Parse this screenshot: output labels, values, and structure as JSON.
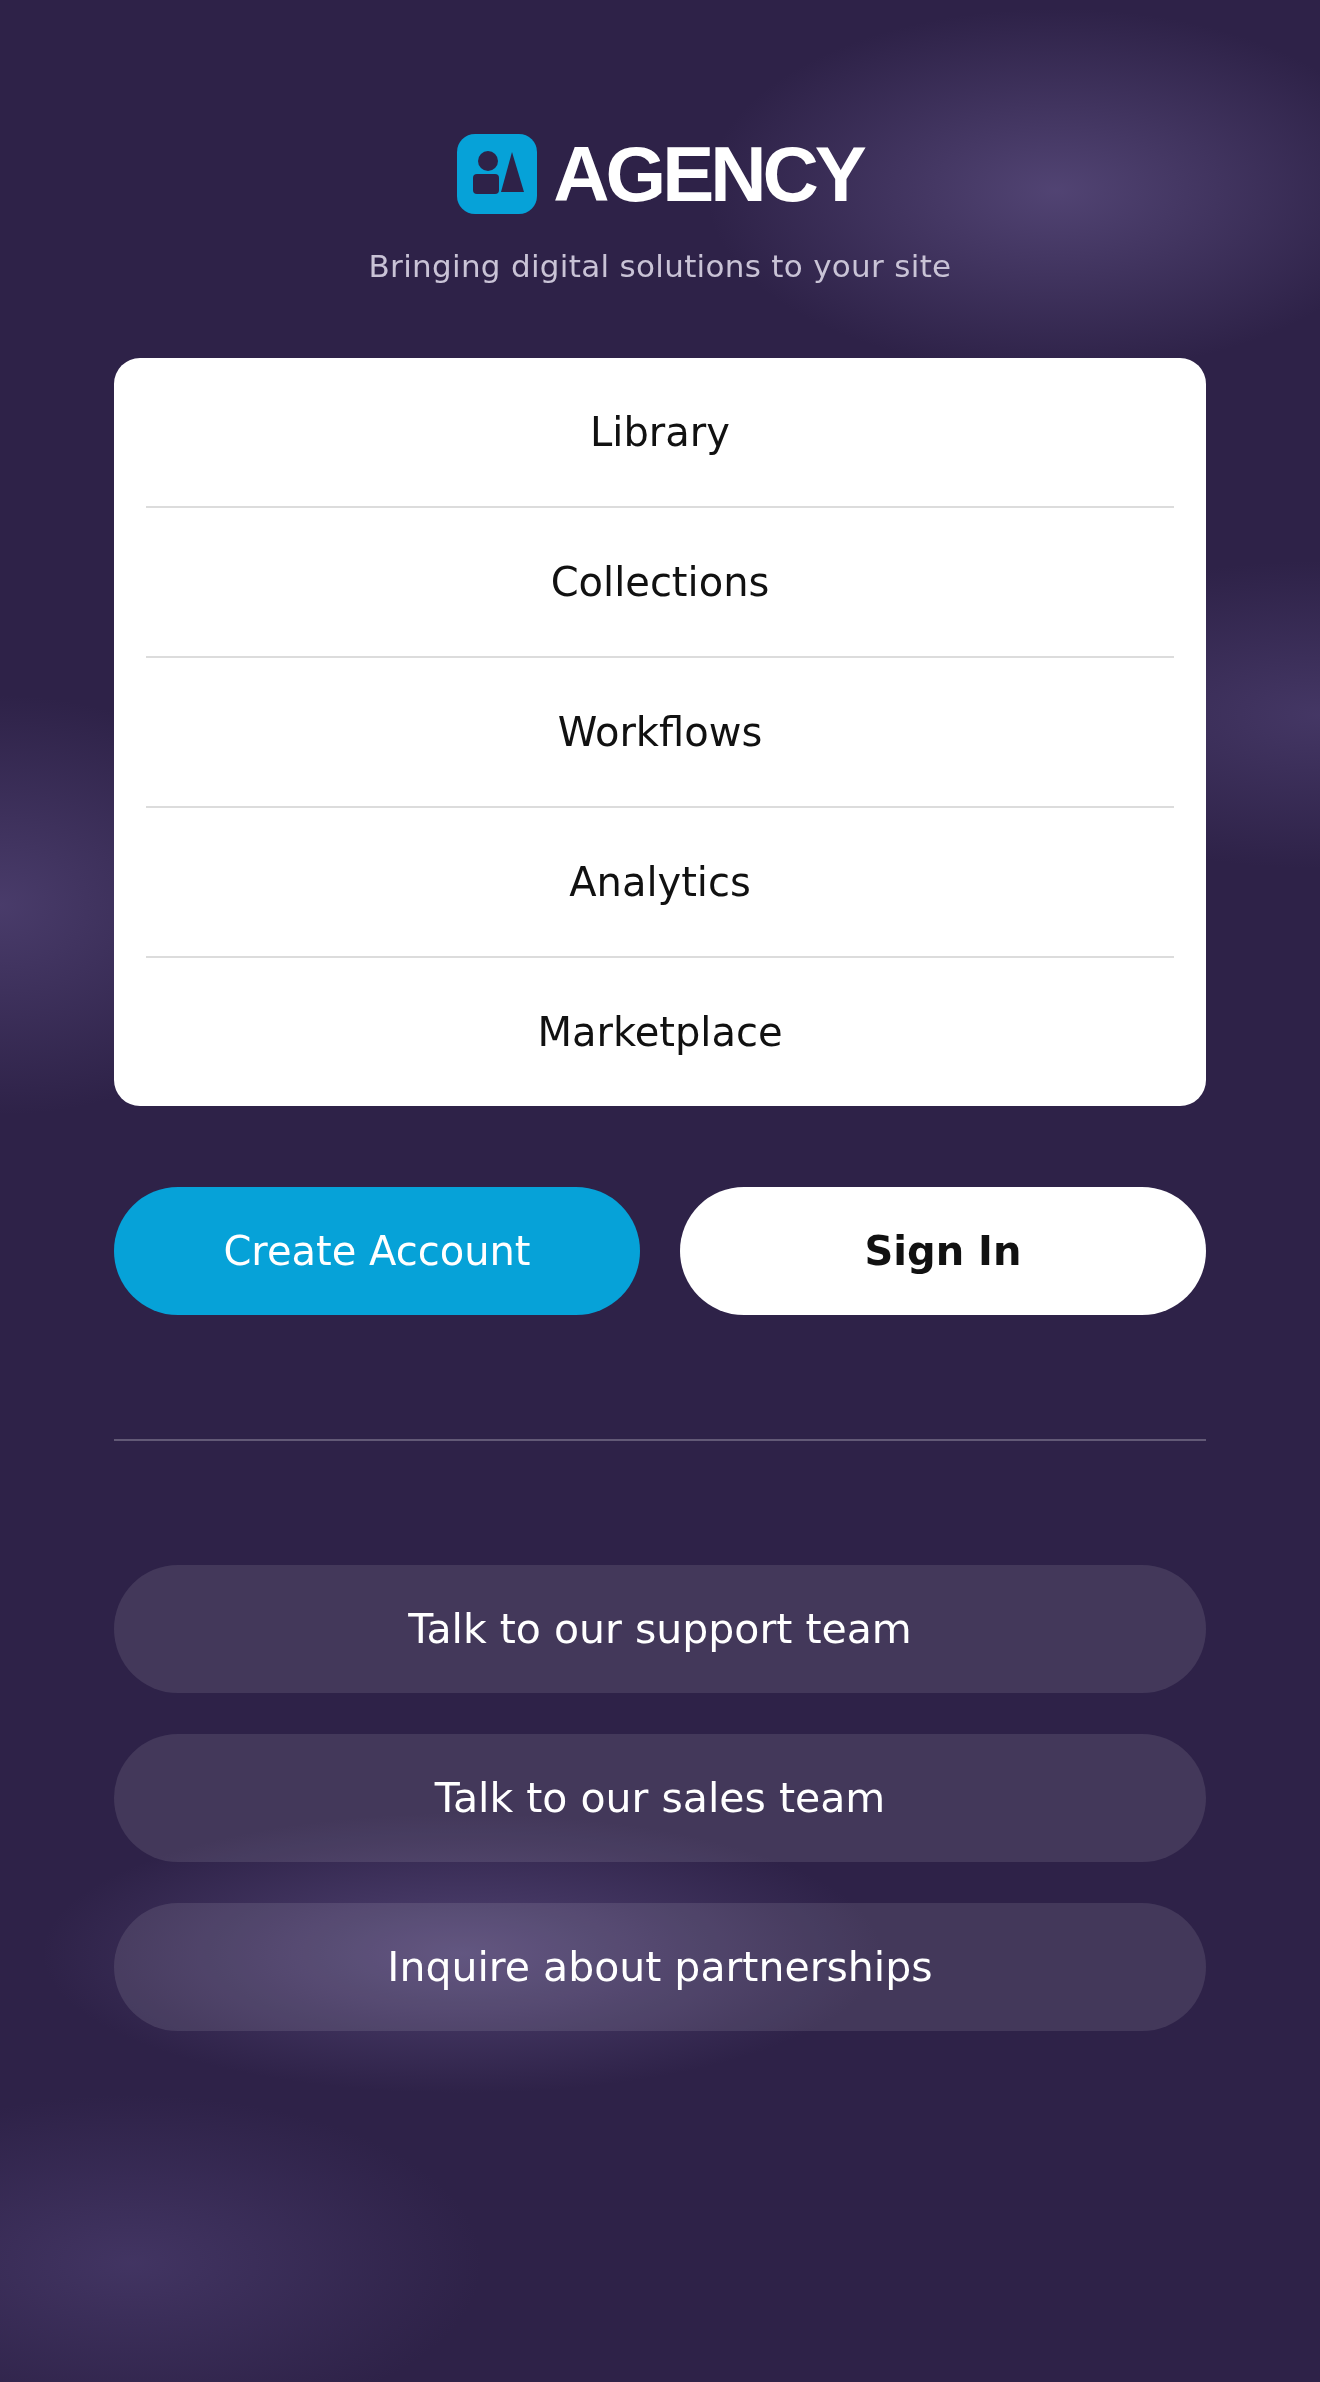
{
  "brand": {
    "name": "AGENCY",
    "tagline": "Bringing digital solutions to your site"
  },
  "menu": [
    {
      "label": "Library"
    },
    {
      "label": "Collections"
    },
    {
      "label": "Workflows"
    },
    {
      "label": "Analytics"
    },
    {
      "label": "Marketplace"
    }
  ],
  "auth_buttons": [
    {
      "label": "Create Account",
      "kind": "primary"
    },
    {
      "label": "Sign In",
      "kind": "secondary"
    }
  ],
  "contact_buttons": [
    {
      "label": "Talk to our support team"
    },
    {
      "label": "Talk to our sales team"
    },
    {
      "label": "Inquire about partnerships"
    }
  ]
}
